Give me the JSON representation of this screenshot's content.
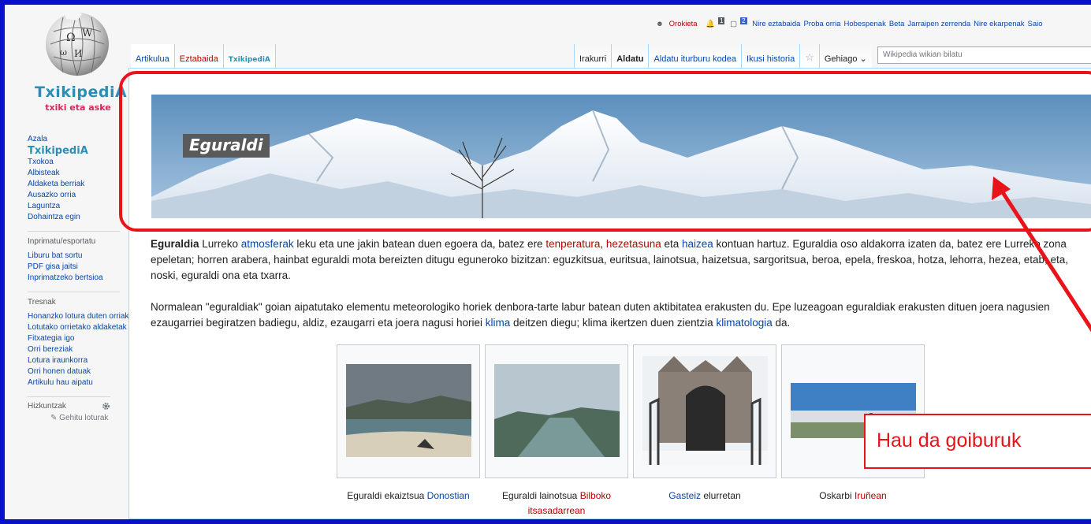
{
  "logo": {
    "title": "TxikipediA",
    "subtitle": "txiki eta aske"
  },
  "sidebar": {
    "main": [
      {
        "label": "Azala",
        "type": "link"
      },
      {
        "label": "TxikipediA",
        "type": "brand"
      },
      {
        "label": "Txokoa",
        "type": "link"
      },
      {
        "label": "Albisteak",
        "type": "link"
      },
      {
        "label": "Aldaketa berriak",
        "type": "link"
      },
      {
        "label": "Ausazko orria",
        "type": "link"
      },
      {
        "label": "Laguntza",
        "type": "link"
      },
      {
        "label": "Dohaintza egin",
        "type": "link"
      }
    ],
    "print_heading": "Inprimatu/esportatu",
    "print": [
      "Liburu bat sortu",
      "PDF gisa jaitsi",
      "Inprimatzeko bertsioa"
    ],
    "tools_heading": "Tresnak",
    "tools": [
      "Honanzko lotura duten orriak",
      "Lotutako orrietako aldaketak",
      "Fitxategia igo",
      "Orri bereziak",
      "Lotura iraunkorra",
      "Orri honen datuak",
      "Artikulu hau aipatu"
    ],
    "lang_heading": "Hizkuntzak",
    "lang_add": "Gehitu loturak"
  },
  "personal": {
    "user": "Orokieta",
    "notif_count": "1",
    "msg_count": "2",
    "links": [
      "Nire eztabaida",
      "Proba orria",
      "Hobespenak",
      "Beta",
      "Jarraipen zerrenda",
      "Nire ekarpenak",
      "Saio"
    ]
  },
  "tabs": {
    "article": "Artikulua",
    "talk": "Eztabaida",
    "txiki": "TxikipediA",
    "read": "Irakurri",
    "edit": "Aldatu",
    "edit_source": "Aldatu iturburu kodea",
    "history": "Ikusi historia",
    "more": "Gehiago",
    "search_placeholder": "Wikipedia wikian bilatu"
  },
  "banner": {
    "title": "Eguraldi"
  },
  "article": {
    "p1": [
      {
        "t": "Eguraldia",
        "c": "b"
      },
      {
        "t": " Lurreko ",
        "c": ""
      },
      {
        "t": "atmosferak",
        "c": "lb"
      },
      {
        "t": " leku eta une jakin batean duen egoera da, batez ere ",
        "c": ""
      },
      {
        "t": "tenperatura",
        "c": "lr"
      },
      {
        "t": ", ",
        "c": ""
      },
      {
        "t": "hezetasuna",
        "c": "lr"
      },
      {
        "t": " eta ",
        "c": ""
      },
      {
        "t": "haizea",
        "c": "lb"
      },
      {
        "t": " kontuan hartuz. Eguraldia oso aldakorra izaten da, batez ere Lurreko zona epeletan; horren arabera, hainbat eguraldi mota bereizten ditugu eguneroko bizitzan: eguzkitsua, euritsua, lainotsua, haizetsua, sargoritsua, beroa, epela, freskoa, hotza, lehorra, hezea, etab; eta, noski, eguraldi ona eta txarra.",
        "c": ""
      }
    ],
    "p2": [
      {
        "t": "Normalean \"eguraldiak\" goian aipatutako elementu meteorologiko horiek denbora-tarte labur batean duten aktibitatea erakusten du. Epe luzeagoan eguraldiak erakusten dituen joera nagusien ezaugarriei begiratzen badiegu, aldiz, ezaugarri eta joera nagusi horiei ",
        "c": ""
      },
      {
        "t": "klima",
        "c": "lb"
      },
      {
        "t": " deitzen diegu; klima ikertzen duen zientzia ",
        "c": ""
      },
      {
        "t": "klimatologia",
        "c": "lb"
      },
      {
        "t": " da.",
        "c": ""
      }
    ]
  },
  "gallery": [
    {
      "caption": [
        {
          "t": "Eguraldi ekaiztsua ",
          "c": ""
        },
        {
          "t": "Donostian",
          "c": "lb"
        }
      ]
    },
    {
      "caption": [
        {
          "t": "Eguraldi lainotsua ",
          "c": ""
        },
        {
          "t": "Bilboko itsasadarrean",
          "c": "lr"
        }
      ]
    },
    {
      "caption": [
        {
          "t": "Gasteiz",
          "c": "lb"
        },
        {
          "t": " elurretan",
          "c": ""
        }
      ]
    },
    {
      "caption": [
        {
          "t": "Oskarbi ",
          "c": ""
        },
        {
          "t": "Iruñean",
          "c": "lr"
        }
      ]
    }
  ],
  "annotation": {
    "callout_text": "Hau da goiburuk",
    "color": "#e8141a"
  }
}
